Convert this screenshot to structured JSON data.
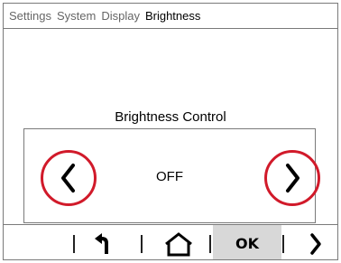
{
  "breadcrumb": {
    "items": [
      "Settings",
      "System",
      "Display",
      "Brightness"
    ]
  },
  "panel": {
    "title": "Brightness Control",
    "value": "OFF"
  },
  "bottom_bar": {
    "ok_label": "OK"
  },
  "colors": {
    "highlight_ring": "#d11a2a",
    "ok_background": "#d8d8d8",
    "border": "#7a7a7a"
  },
  "icons": {
    "decrease": "chevron-left-icon",
    "increase": "chevron-right-icon",
    "back": "back-arrow-icon",
    "home": "home-icon",
    "next": "chevron-right-icon"
  }
}
